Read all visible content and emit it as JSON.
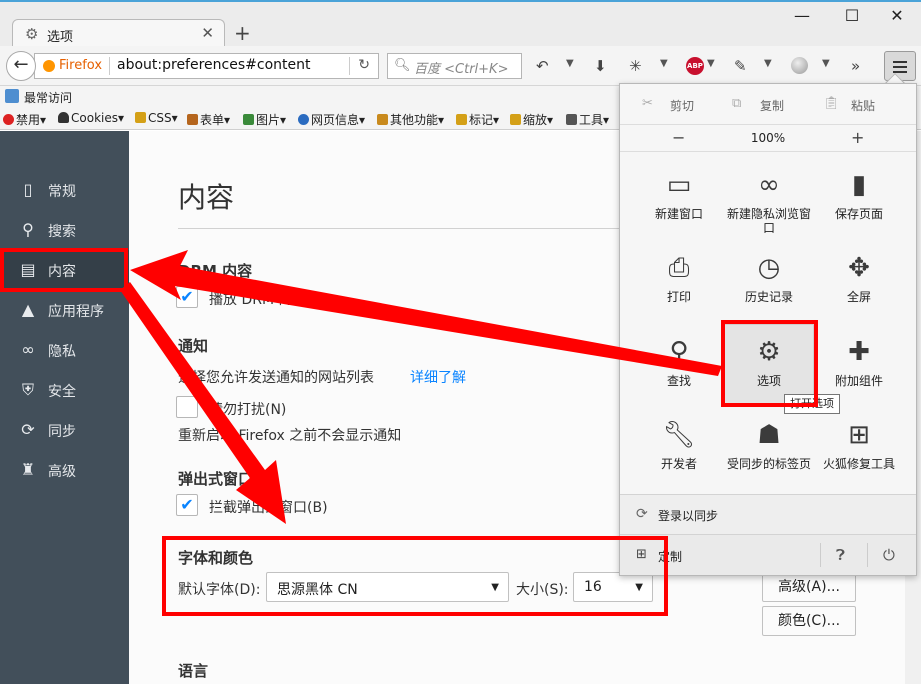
{
  "colors": {
    "accent": "#0a84ff",
    "sidebar_bg": "#424f5a",
    "highlight_red": "#ff0000",
    "active_marker": "#ff9500"
  },
  "window": {
    "tab_title": "选项",
    "tab_icon": "gear-icon",
    "minimize": "—",
    "maximize": "☐",
    "close": "✕"
  },
  "navbar": {
    "identity_label": "Firefox",
    "url": "about:preferences#content",
    "search_placeholder": "百度 <Ctrl+K>"
  },
  "bookmarks": {
    "most_visited": "最常访问",
    "webdev_items": [
      "禁用▾",
      "Cookies▾",
      "CSS▾",
      "表单▾",
      "图片▾",
      "网页信息▾",
      "其他功能▾",
      "标记▾",
      "缩放▾",
      "工具▾"
    ]
  },
  "sidebar": {
    "items": [
      {
        "label": "常规",
        "icon": "general-icon"
      },
      {
        "label": "搜索",
        "icon": "search-icon"
      },
      {
        "label": "内容",
        "icon": "content-icon",
        "active": true
      },
      {
        "label": "应用程序",
        "icon": "applications-icon"
      },
      {
        "label": "隐私",
        "icon": "privacy-mask-icon"
      },
      {
        "label": "安全",
        "icon": "security-icon"
      },
      {
        "label": "同步",
        "icon": "sync-icon"
      },
      {
        "label": "高级",
        "icon": "advanced-icon"
      }
    ]
  },
  "content": {
    "title": "内容",
    "drm": {
      "heading": "DRM 内容",
      "checkbox_label": "播放 DRM 内容(P)",
      "checked": true
    },
    "notifications": {
      "heading": "通知",
      "description": "选择您允许发送通知的网站列表",
      "learn_more": "详细了解",
      "dnd_label": "请勿打扰(N)",
      "dnd_checked": false,
      "hint": "重新启动 Firefox 之前不会显示通知"
    },
    "popups": {
      "heading": "弹出式窗口",
      "block_label": "拦截弹出式窗口(B)",
      "checked": true
    },
    "fonts": {
      "heading": "字体和颜色",
      "default_font_label": "默认字体(D):",
      "default_font_value": "思源黑体 CN",
      "size_label": "大小(S):",
      "size_value": "16",
      "advanced_button": "高级(A)...",
      "colors_button": "颜色(C)..."
    },
    "languages": {
      "heading": "语言"
    }
  },
  "menu_panel": {
    "edit": {
      "cut": "剪切",
      "copy": "复制",
      "paste": "粘贴"
    },
    "zoom": {
      "minus": "−",
      "value": "100%",
      "plus": "+"
    },
    "items": [
      {
        "label": "新建窗口",
        "icon": "new-window-icon"
      },
      {
        "label": "新建隐私浏览窗口",
        "icon": "private-mask-icon"
      },
      {
        "label": "保存页面",
        "icon": "save-page-icon"
      },
      {
        "label": "打印",
        "icon": "print-icon"
      },
      {
        "label": "历史记录",
        "icon": "history-icon"
      },
      {
        "label": "全屏",
        "icon": "fullscreen-icon"
      },
      {
        "label": "查找",
        "icon": "find-icon"
      },
      {
        "label": "选项",
        "icon": "options-gear-icon"
      },
      {
        "label": "附加组件",
        "icon": "addons-puzzle-icon"
      },
      {
        "label": "开发者",
        "icon": "developer-wrench-icon"
      },
      {
        "label": "受同步的标签页",
        "icon": "synced-tabs-icon"
      },
      {
        "label": "火狐修复工具",
        "icon": "repair-kit-icon"
      }
    ],
    "tooltip": "打开选项",
    "sign_in": "登录以同步",
    "customize": "定制"
  }
}
